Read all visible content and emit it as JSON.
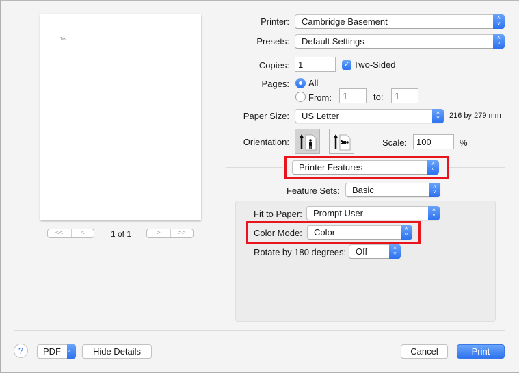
{
  "preview": {
    "page_text": "Text",
    "first_page_glyph": "<<",
    "prev_page_glyph": "<",
    "next_page_glyph": ">",
    "last_page_glyph": ">>",
    "page_indicator": "1 of 1"
  },
  "settings": {
    "printer": {
      "label": "Printer:",
      "value": "Cambridge Basement"
    },
    "presets": {
      "label": "Presets:",
      "value": "Default Settings"
    },
    "copies": {
      "label": "Copies:",
      "value": "1"
    },
    "two_sided": {
      "label": "Two-Sided",
      "checked": true
    },
    "pages": {
      "label": "Pages:",
      "all_label": "All",
      "from_label": "From:",
      "from_value": "1",
      "to_label": "to:",
      "to_value": "1",
      "selected": "All"
    },
    "paper_size": {
      "label": "Paper Size:",
      "value": "US Letter",
      "dimensions": "216 by 279 mm"
    },
    "orientation": {
      "label": "Orientation:",
      "options": [
        "Portrait",
        "Landscape"
      ],
      "selected": "Portrait"
    },
    "scale": {
      "label": "Scale:",
      "value": "100",
      "unit": "%"
    },
    "section_menu": {
      "value": "Printer Features"
    },
    "feature_sets": {
      "label": "Feature Sets:",
      "value": "Basic"
    },
    "fit_to_paper": {
      "label": "Fit to Paper:",
      "value": "Prompt User"
    },
    "color_mode": {
      "label": "Color Mode:",
      "value": "Color"
    },
    "rotate": {
      "label": "Rotate by 180 degrees:",
      "value": "Off"
    }
  },
  "footer": {
    "help_glyph": "?",
    "pdf_label": "PDF",
    "hide_details_label": "Hide Details",
    "cancel_label": "Cancel",
    "print_label": "Print"
  },
  "icons": {
    "stepper": "⌃⌄",
    "checkmark": "✓",
    "chevron_down": "⌄"
  },
  "colors": {
    "accent": "#2f73ef",
    "highlight_box": "#e8141e"
  }
}
